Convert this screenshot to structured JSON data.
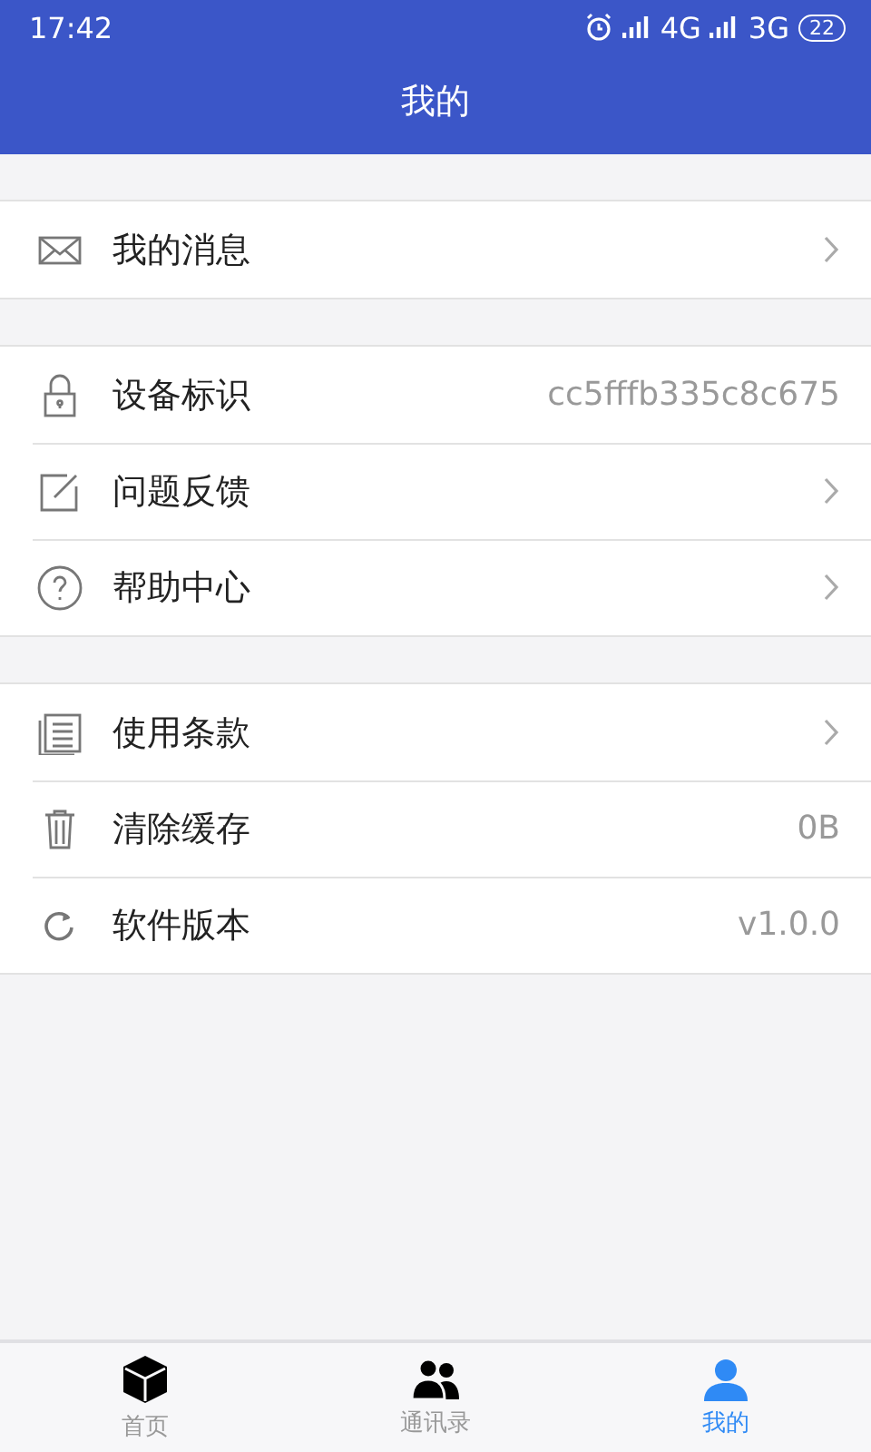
{
  "status_bar": {
    "time": "17:42",
    "network_1": "4G",
    "network_2": "3G",
    "battery": "22"
  },
  "header": {
    "title": "我的"
  },
  "groups": [
    {
      "items": [
        {
          "label": "我的消息",
          "kind": "link"
        }
      ]
    },
    {
      "items": [
        {
          "label": "设备标识",
          "kind": "value",
          "value": "cc5fffb335c8c675"
        },
        {
          "label": "问题反馈",
          "kind": "link"
        },
        {
          "label": "帮助中心",
          "kind": "link"
        }
      ]
    },
    {
      "items": [
        {
          "label": "使用条款",
          "kind": "link"
        },
        {
          "label": "清除缓存",
          "kind": "value",
          "value": "0B"
        },
        {
          "label": "软件版本",
          "kind": "value",
          "value": "v1.0.0"
        }
      ]
    }
  ],
  "tabs": [
    {
      "label": "首页",
      "selected": false
    },
    {
      "label": "通讯录",
      "selected": false
    },
    {
      "label": "我的",
      "selected": true
    }
  ]
}
